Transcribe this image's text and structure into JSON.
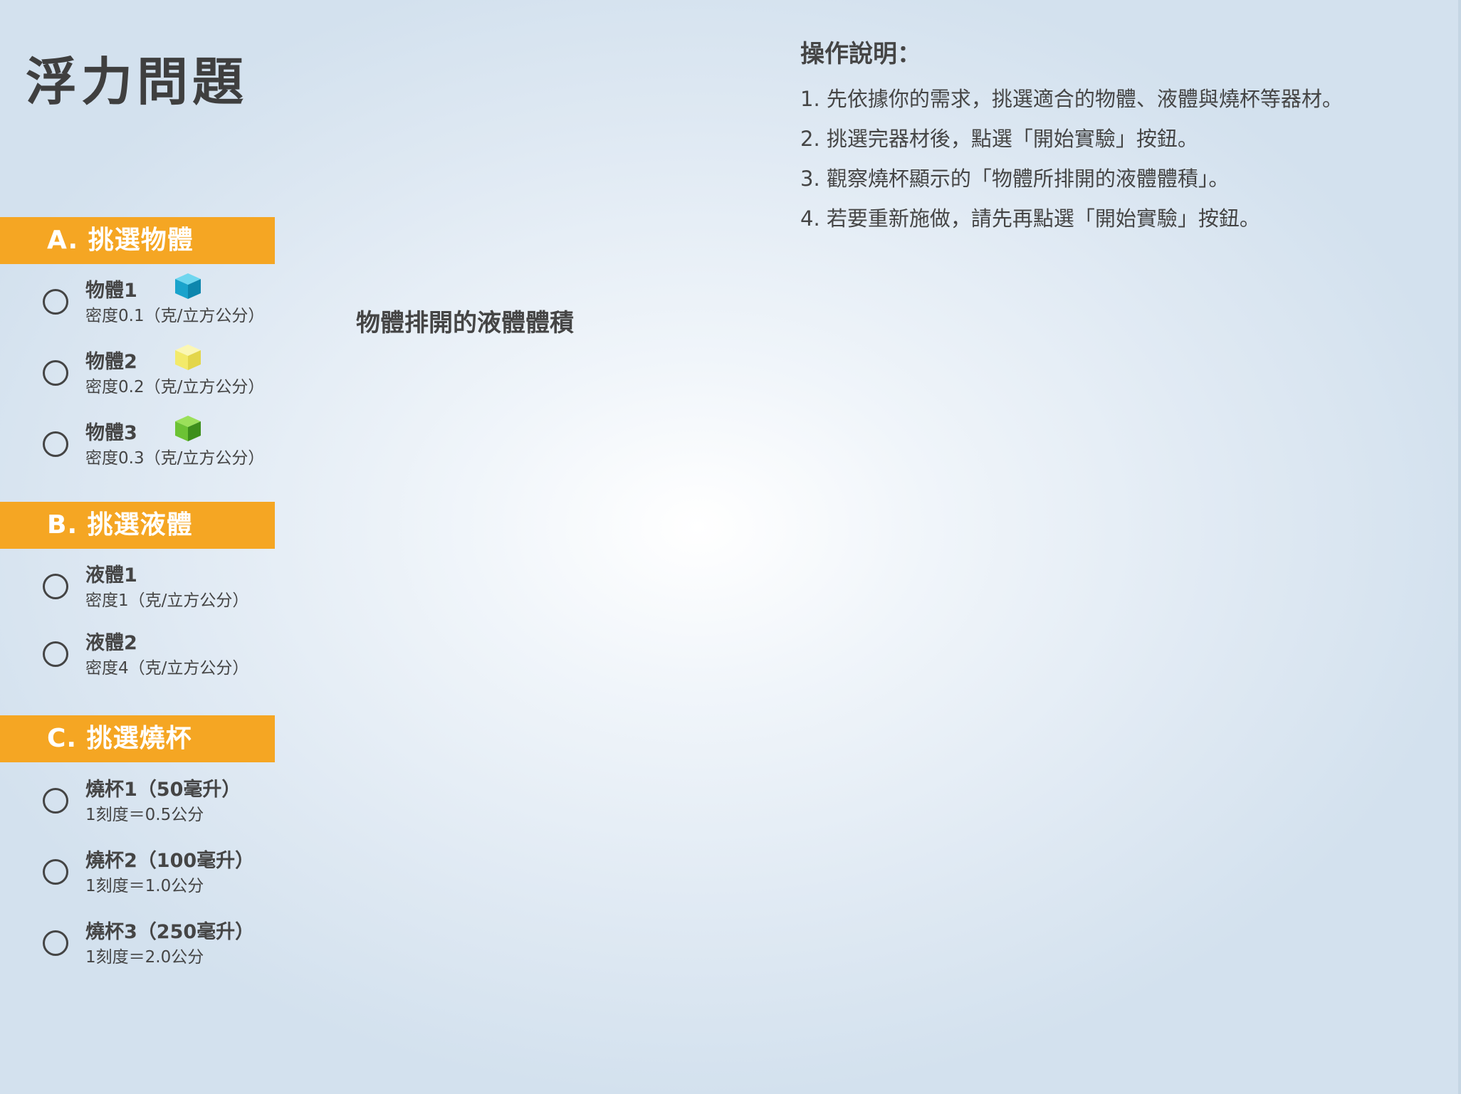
{
  "title": "浮力問題",
  "sections": {
    "objects": {
      "header": "A. 挑選物體",
      "options": [
        {
          "name": "物體1",
          "desc": "密度0.1（克/立方公分）",
          "icon": "cyan-cube-icon",
          "color": "#1aa3cc"
        },
        {
          "name": "物體2",
          "desc": "密度0.2（克/立方公分）",
          "icon": "yellow-cube-icon",
          "color": "#f3ea6a"
        },
        {
          "name": "物體3",
          "desc": "密度0.3（克/立方公分）",
          "icon": "green-cube-icon",
          "color": "#5fb82e"
        }
      ]
    },
    "liquids": {
      "header": "B. 挑選液體",
      "options": [
        {
          "name": "液體1",
          "desc": "密度1（克/立方公分）"
        },
        {
          "name": "液體2",
          "desc": "密度4（克/立方公分）"
        }
      ]
    },
    "beakers": {
      "header": "C. 挑選燒杯",
      "options": [
        {
          "name": "燒杯1（50毫升）",
          "desc": "1刻度＝0.5公分"
        },
        {
          "name": "燒杯2（100毫升）",
          "desc": "1刻度＝1.0公分"
        },
        {
          "name": "燒杯3（250毫升）",
          "desc": "1刻度＝2.0公分"
        }
      ]
    }
  },
  "volume_label": "物體排開的液體體積",
  "instructions": {
    "title": "操作說明：",
    "steps": [
      "1. 先依據你的需求，挑選適合的物體、液體與燒杯等器材。",
      "2. 挑選完器材後，點選「開始實驗」按鈕。",
      "3. 觀察燒杯顯示的「物體所排開的液體體積」。",
      "4. 若要重新施做，請先再點選「開始實驗」按鈕。"
    ]
  },
  "colors": {
    "accent": "#f5a623",
    "text": "#454545"
  }
}
